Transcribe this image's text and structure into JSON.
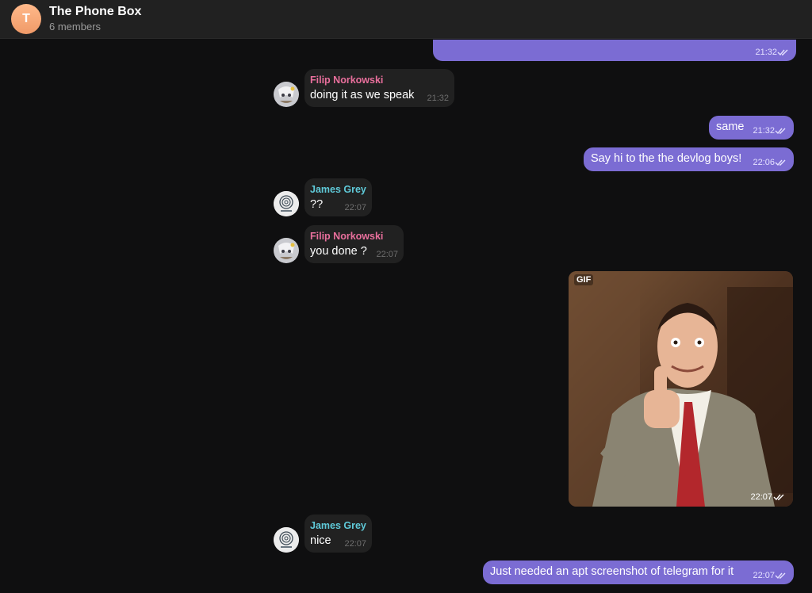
{
  "header": {
    "avatar_letter": "T",
    "title": "The Phone Box",
    "subtitle": "6 members",
    "avatar_color": "#f6a274"
  },
  "colors": {
    "background": "#0f0f10",
    "incoming_bubble": "#212121",
    "outgoing_bubble": "#7b6cd3",
    "name_filip": "#e86f9c",
    "name_james": "#5fc9d8"
  },
  "messages": [
    {
      "id": "m0",
      "direction": "out",
      "text": "",
      "time": "21:32",
      "status": "read"
    },
    {
      "id": "m1",
      "direction": "in",
      "sender": "Filip Norkowski",
      "text": "doing it as we speak",
      "time": "21:32"
    },
    {
      "id": "m2",
      "direction": "out",
      "text": "same",
      "time": "21:32",
      "status": "read"
    },
    {
      "id": "m3",
      "direction": "out",
      "text": "Say hi to the the devlog boys!",
      "time": "22:06",
      "status": "read"
    },
    {
      "id": "m4",
      "direction": "in",
      "sender": "James Grey",
      "text": "??",
      "time": "22:07"
    },
    {
      "id": "m5",
      "direction": "in",
      "sender": "Filip Norkowski",
      "text": "you done ?",
      "time": "22:07"
    },
    {
      "id": "m6",
      "direction": "out",
      "type": "gif",
      "gif_label": "GIF",
      "time": "22:07",
      "status": "read"
    },
    {
      "id": "m7",
      "direction": "in",
      "sender": "James Grey",
      "text": "nice",
      "time": "22:07"
    },
    {
      "id": "m8",
      "direction": "out",
      "text": "Just needed an apt screenshot of telegram for it",
      "time": "22:07",
      "status": "read"
    }
  ]
}
